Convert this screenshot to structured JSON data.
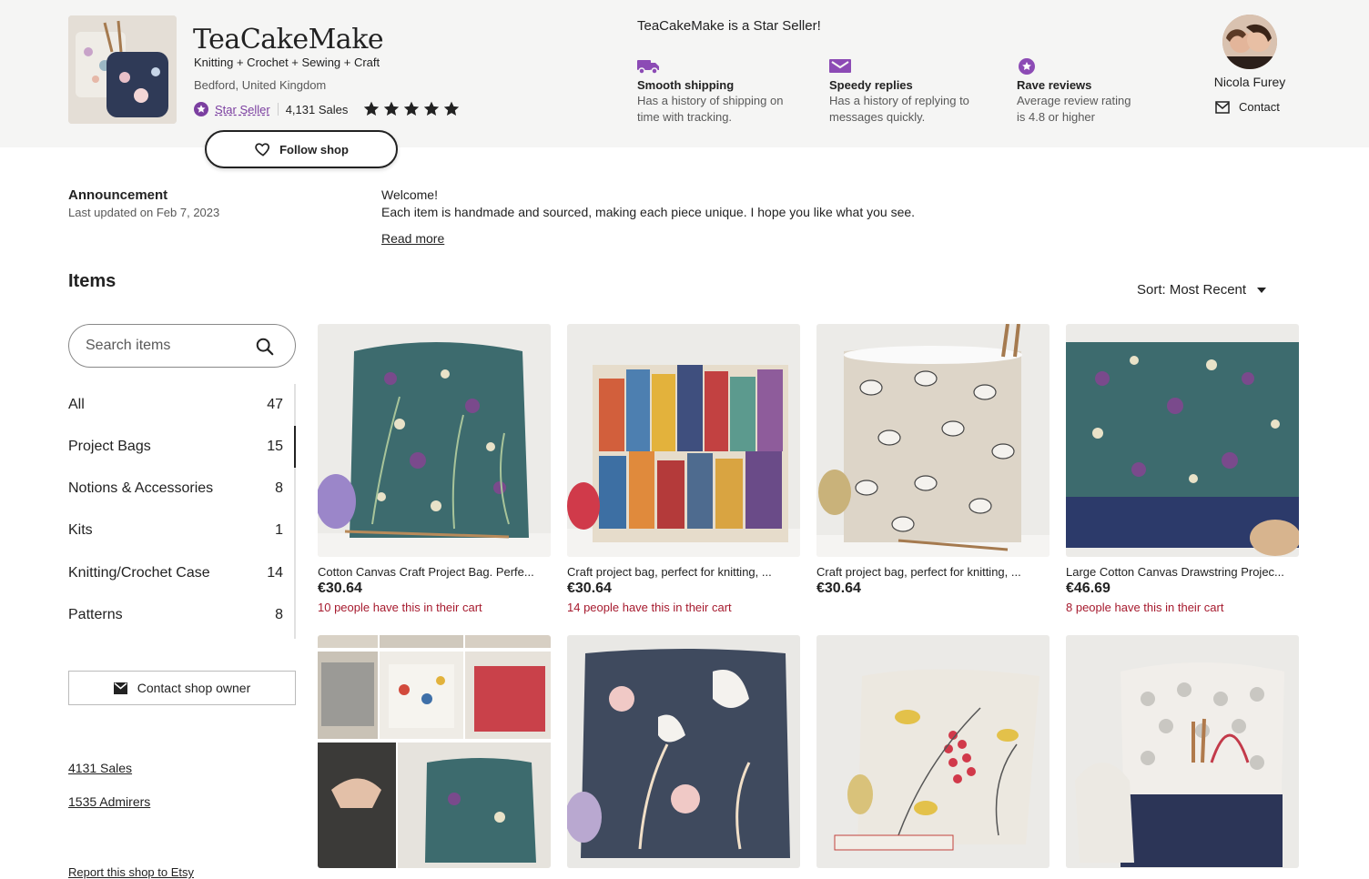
{
  "shop": {
    "name": "TeaCakeMake",
    "tagline": "Knitting + Crochet + Sewing + Craft",
    "location": "Bedford, United Kingdom",
    "star_seller": "Star Seller",
    "sales": "4,131 Sales",
    "rating": 5,
    "follow": "Follow shop"
  },
  "star_seller_box": {
    "title": "TeaCakeMake is a Star Seller!",
    "perks": [
      {
        "title": "Smooth shipping",
        "desc1": "Has a history of shipping on",
        "desc2": "time with tracking.",
        "icon": "truck-icon"
      },
      {
        "title": "Speedy replies",
        "desc1": "Has a history of replying to",
        "desc2": "messages quickly.",
        "icon": "message-icon"
      },
      {
        "title": "Rave reviews",
        "desc1": "Average review rating",
        "desc2": "is 4.8 or higher",
        "icon": "star-badge-icon"
      }
    ]
  },
  "owner": {
    "name": "Nicola Furey",
    "contact": "Contact"
  },
  "announcement": {
    "title": "Announcement",
    "updated": "Last updated on Feb 7, 2023",
    "welcome": "Welcome!",
    "text": "Each item is handmade and sourced, making each piece unique. I hope you like what you see.",
    "read_more": "Read more"
  },
  "items": {
    "title": "Items",
    "sort": "Sort: Most Recent",
    "search_placeholder": "Search items"
  },
  "categories": [
    {
      "label": "All",
      "count": "47"
    },
    {
      "label": "Project Bags",
      "count": "15"
    },
    {
      "label": "Notions & Accessories",
      "count": "8"
    },
    {
      "label": "Kits",
      "count": "1"
    },
    {
      "label": "Knitting/Crochet Case",
      "count": "14"
    },
    {
      "label": "Patterns",
      "count": "8"
    }
  ],
  "sidebar": {
    "contact_owner": "Contact shop owner",
    "sales_link": "4131 Sales",
    "admirers_link": "1535 Admirers",
    "report_link": "Report this shop to Etsy"
  },
  "listings": [
    {
      "title": "Cotton Canvas Craft Project Bag. Perfe...",
      "price": "€30.64",
      "cart": "10 people have this in their cart"
    },
    {
      "title": "Craft project bag, perfect for knitting, ...",
      "price": "€30.64",
      "cart": "14 people have this in their cart"
    },
    {
      "title": "Craft project bag, perfect for knitting, ...",
      "price": "€30.64",
      "cart": ""
    },
    {
      "title": "Large Cotton Canvas Drawstring Projec...",
      "price": "€46.69",
      "cart": "8 people have this in their cart"
    }
  ],
  "colors": {
    "accent": "#7b3fa0",
    "cart": "#a61a2e",
    "band": "#f5f5f4"
  }
}
